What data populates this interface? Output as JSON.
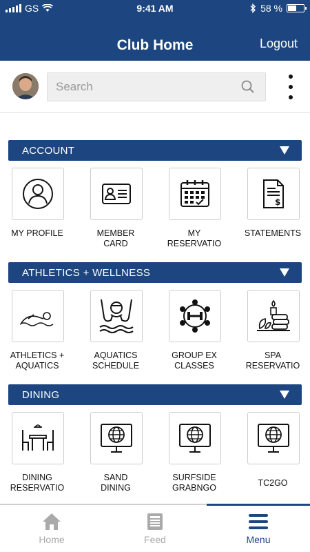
{
  "status_bar": {
    "carrier": "GS",
    "time": "9:41 AM",
    "battery": "58 %",
    "battery_level": 0.58
  },
  "header": {
    "title": "Club Home",
    "logout_label": "Logout"
  },
  "search": {
    "placeholder": "Search"
  },
  "sections": [
    {
      "title": "ACCOUNT",
      "items": [
        {
          "label": "MY PROFILE",
          "icon": "profile-icon"
        },
        {
          "label": "MEMBER\nCARD",
          "icon": "member-card-icon"
        },
        {
          "label": "MY\nRESERVATIO",
          "icon": "calendar-icon"
        },
        {
          "label": "STATEMENTS",
          "icon": "statement-icon"
        }
      ]
    },
    {
      "title": "ATHLETICS + WELLNESS",
      "items": [
        {
          "label": "ATHLETICS +\nAQUATICS",
          "icon": "swimmer-icon"
        },
        {
          "label": "AQUATICS\nSCHEDULE",
          "icon": "swimmer-front-icon"
        },
        {
          "label": "GROUP EX\nCLASSES",
          "icon": "group-dumbbell-icon"
        },
        {
          "label": "SPA\nRESERVATIO",
          "icon": "spa-icon"
        }
      ]
    },
    {
      "title": "DINING",
      "items": [
        {
          "label": "DINING\nRESERVATIO",
          "icon": "dining-table-icon"
        },
        {
          "label": "SAND\nDINING",
          "icon": "globe-monitor-icon"
        },
        {
          "label": "SURFSIDE\nGRABNGO",
          "icon": "globe-monitor-icon"
        },
        {
          "label": "TC2GO",
          "icon": "globe-monitor-icon"
        }
      ]
    }
  ],
  "tabbar": {
    "items": [
      {
        "label": "Home",
        "icon": "home-icon"
      },
      {
        "label": "Feed",
        "icon": "feed-icon"
      },
      {
        "label": "Menu",
        "icon": "menu-icon"
      }
    ],
    "active": "Menu"
  },
  "colors": {
    "primary": "#1d4680",
    "inactive": "#aaaaaa"
  }
}
